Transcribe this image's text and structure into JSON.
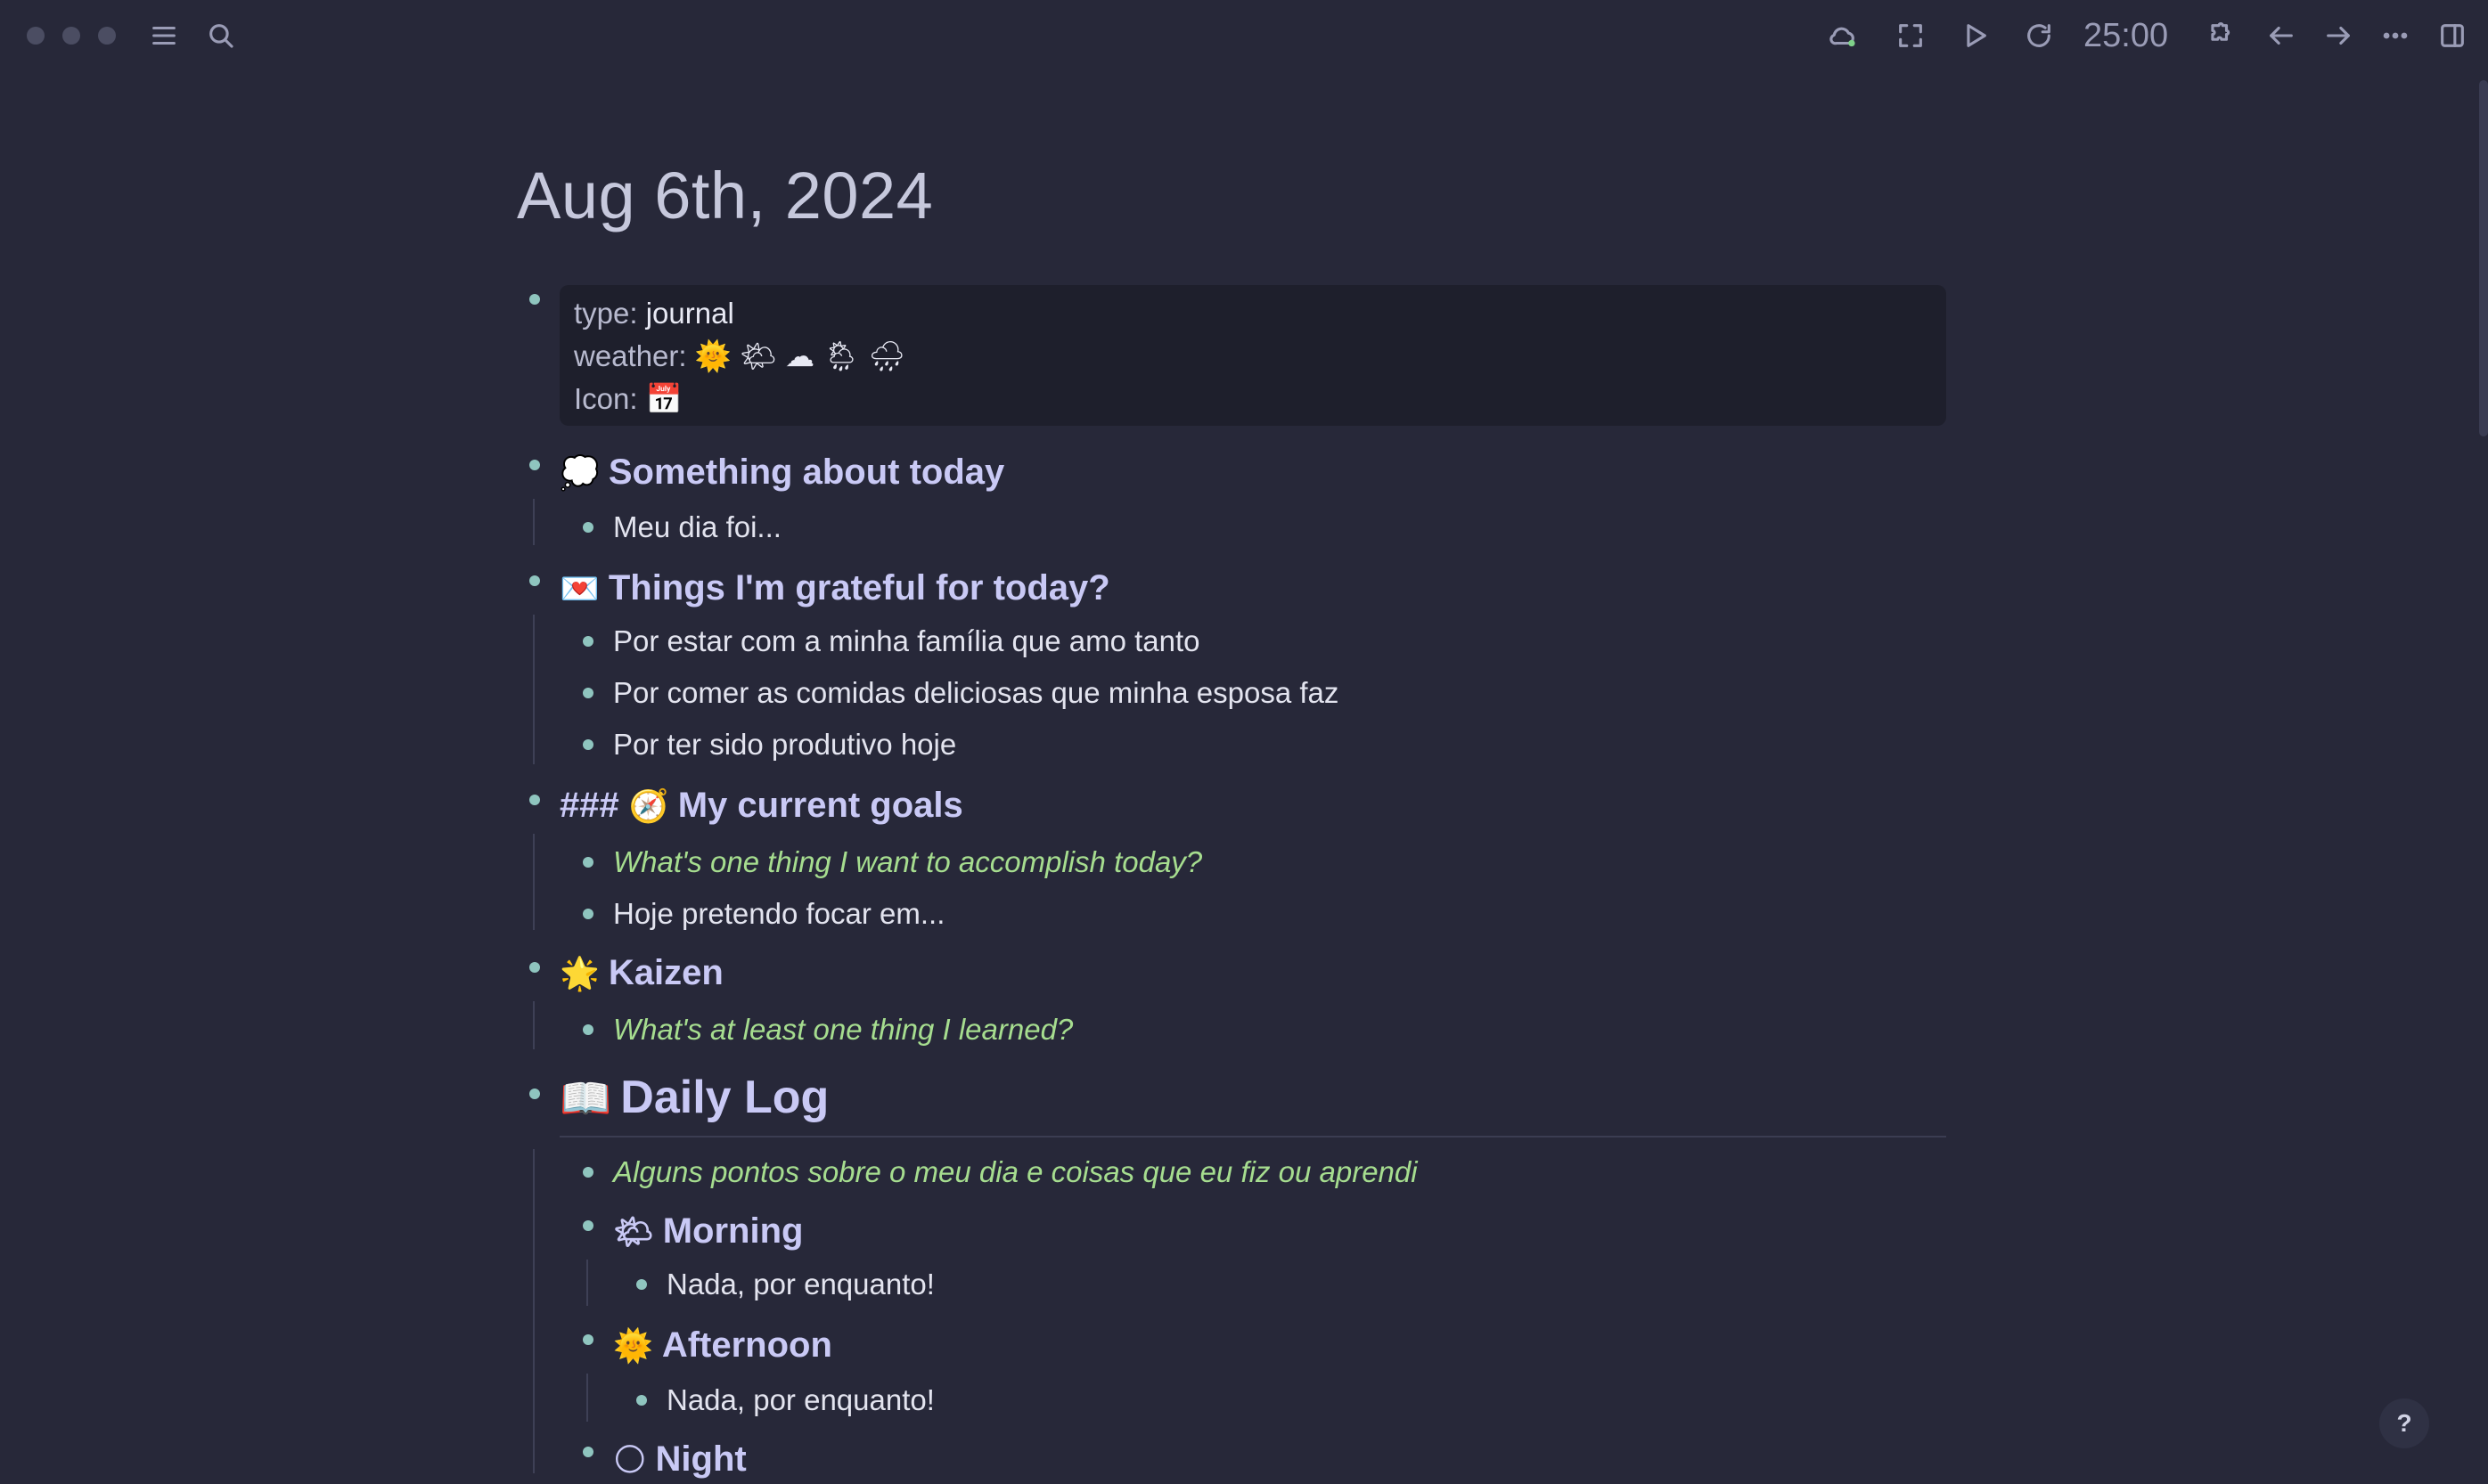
{
  "toolbar": {
    "timer": "25:00",
    "icons": [
      "menu-icon",
      "search-icon",
      "cloud-sync-icon",
      "fullscreen-icon",
      "play-icon",
      "refresh-icon",
      "puzzle-icon",
      "arrow-left-icon",
      "arrow-right-icon",
      "more-icon",
      "sidebar-toggle-icon"
    ]
  },
  "page": {
    "title": "Aug 6th, 2024",
    "properties": {
      "type_key": "type:",
      "type_value": "journal",
      "weather_key": "weather:",
      "weather_value": "🌞 🌤 ☁ 🌦 🌧",
      "icon_key": "Icon:",
      "icon_value": "📅"
    },
    "sections": {
      "today": {
        "emoji": "💭",
        "heading": "Something about today",
        "items": [
          "Meu dia foi..."
        ]
      },
      "grateful": {
        "emoji": "💌",
        "heading": "Things I'm grateful for today?",
        "items": [
          "Por estar com a minha família que amo tanto",
          "Por comer as comidas deliciosas que minha esposa faz",
          "Por ter sido produtivo hoje"
        ]
      },
      "goals": {
        "prefix": "###",
        "emoji": "🧭",
        "heading": "My current goals",
        "prompt": "What's one thing I want to accomplish today?",
        "items": [
          "Hoje pretendo focar em..."
        ]
      },
      "kaizen": {
        "emoji": "🌟",
        "heading": "Kaizen",
        "prompt": "What's at least one thing I learned?"
      },
      "daily_log": {
        "emoji": "📖",
        "heading": "Daily Log",
        "prompt": "Alguns pontos sobre o meu dia e coisas que eu fiz ou aprendi",
        "morning": {
          "emoji": "🌤",
          "heading": "Morning",
          "items": [
            "Nada, por enquanto!"
          ]
        },
        "afternoon": {
          "emoji": "🌞",
          "heading": "Afternoon",
          "items": [
            "Nada, por enquanto!"
          ]
        },
        "night": {
          "emoji": "🌕",
          "heading": "Night"
        }
      }
    }
  },
  "help": {
    "label": "?"
  }
}
